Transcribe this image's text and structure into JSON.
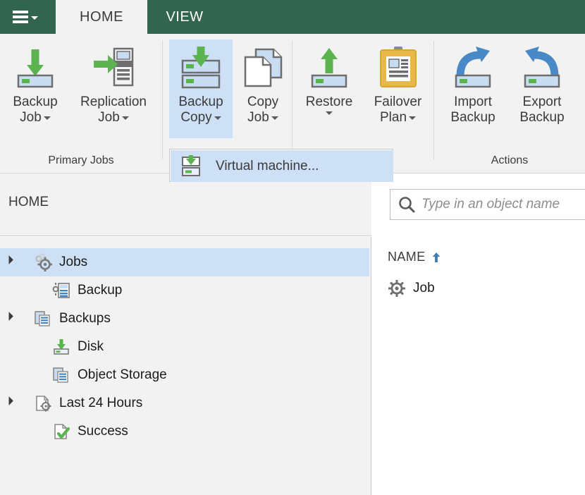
{
  "window": {
    "menu_button_icon": "hamburger-icon",
    "tabs": [
      {
        "label": "HOME",
        "active": true
      },
      {
        "label": "VIEW",
        "active": false
      }
    ]
  },
  "ribbon": {
    "groups": [
      {
        "name": "primary-jobs",
        "label": "Primary Jobs",
        "buttons": [
          {
            "name": "backup-job",
            "line1": "Backup",
            "line2": "Job",
            "has_dropdown": true,
            "icon": "backup-job-icon",
            "selected": false
          },
          {
            "name": "replication-job",
            "line1": "Replication",
            "line2": "Job",
            "has_dropdown": true,
            "icon": "replication-job-icon",
            "selected": false
          }
        ]
      },
      {
        "name": "secondary-jobs",
        "label": "",
        "buttons": [
          {
            "name": "backup-copy",
            "line1": "Backup",
            "line2": "Copy",
            "has_dropdown": true,
            "icon": "backup-copy-icon",
            "selected": true
          },
          {
            "name": "copy-job",
            "line1": "Copy",
            "line2": "Job",
            "has_dropdown": true,
            "icon": "copy-job-icon",
            "selected": false
          }
        ]
      },
      {
        "name": "restore-group",
        "label": "",
        "buttons": [
          {
            "name": "restore",
            "line1": "Restore",
            "line2": "",
            "has_dropdown": true,
            "icon": "restore-icon",
            "selected": false
          },
          {
            "name": "failover-plan",
            "line1": "Failover",
            "line2": "Plan",
            "has_dropdown": true,
            "icon": "failover-plan-icon",
            "selected": false
          }
        ]
      },
      {
        "name": "actions",
        "label": "Actions",
        "buttons": [
          {
            "name": "import-backup",
            "line1": "Import",
            "line2": "Backup",
            "has_dropdown": false,
            "icon": "import-backup-icon",
            "selected": false
          },
          {
            "name": "export-backup",
            "line1": "Export",
            "line2": "Backup",
            "has_dropdown": false,
            "icon": "export-backup-icon",
            "selected": false
          }
        ]
      }
    ]
  },
  "dropdown": {
    "open": true,
    "owner": "backup-copy",
    "items": [
      {
        "label": "Virtual machine...",
        "icon": "virtual-machine-backup-icon",
        "highlighted": true
      }
    ]
  },
  "breadcrumb": {
    "label": "HOME"
  },
  "sidebar": {
    "items": [
      {
        "label": "Jobs",
        "icon": "jobs-gear-icon",
        "level": 0,
        "expandable": true,
        "expanded": true,
        "selected": true
      },
      {
        "label": "Backup",
        "icon": "backup-job-tree-icon",
        "level": 1,
        "expandable": false,
        "expanded": false,
        "selected": false
      },
      {
        "label": "Backups",
        "icon": "backups-icon",
        "level": 0,
        "expandable": true,
        "expanded": true,
        "selected": false
      },
      {
        "label": "Disk",
        "icon": "disk-backup-icon",
        "level": 1,
        "expandable": false,
        "expanded": false,
        "selected": false
      },
      {
        "label": "Object Storage",
        "icon": "object-storage-icon",
        "level": 1,
        "expandable": false,
        "expanded": false,
        "selected": false
      },
      {
        "label": "Last 24 Hours",
        "icon": "last-24-hours-icon",
        "level": 0,
        "expandable": true,
        "expanded": true,
        "selected": false
      },
      {
        "label": "Success",
        "icon": "success-icon",
        "level": 1,
        "expandable": false,
        "expanded": false,
        "selected": false
      }
    ]
  },
  "main": {
    "search": {
      "placeholder": "Type in an object name",
      "value": "",
      "icon": "search-icon"
    },
    "columns": [
      {
        "label": "NAME",
        "sort": "asc",
        "sort_icon": "sort-ascending-arrow-icon"
      }
    ],
    "rows": [
      {
        "name": "Job",
        "icon": "job-gear-icon"
      }
    ]
  },
  "colors": {
    "title_bar_green": "#31654f",
    "ribbon_bg": "#f2f2f2",
    "selection_blue": "#cde0f5",
    "accent_green": "#5cb450",
    "accent_blue": "#4a89c7",
    "accent_amber": "#e8b84b",
    "text": "#3b3b3b"
  }
}
